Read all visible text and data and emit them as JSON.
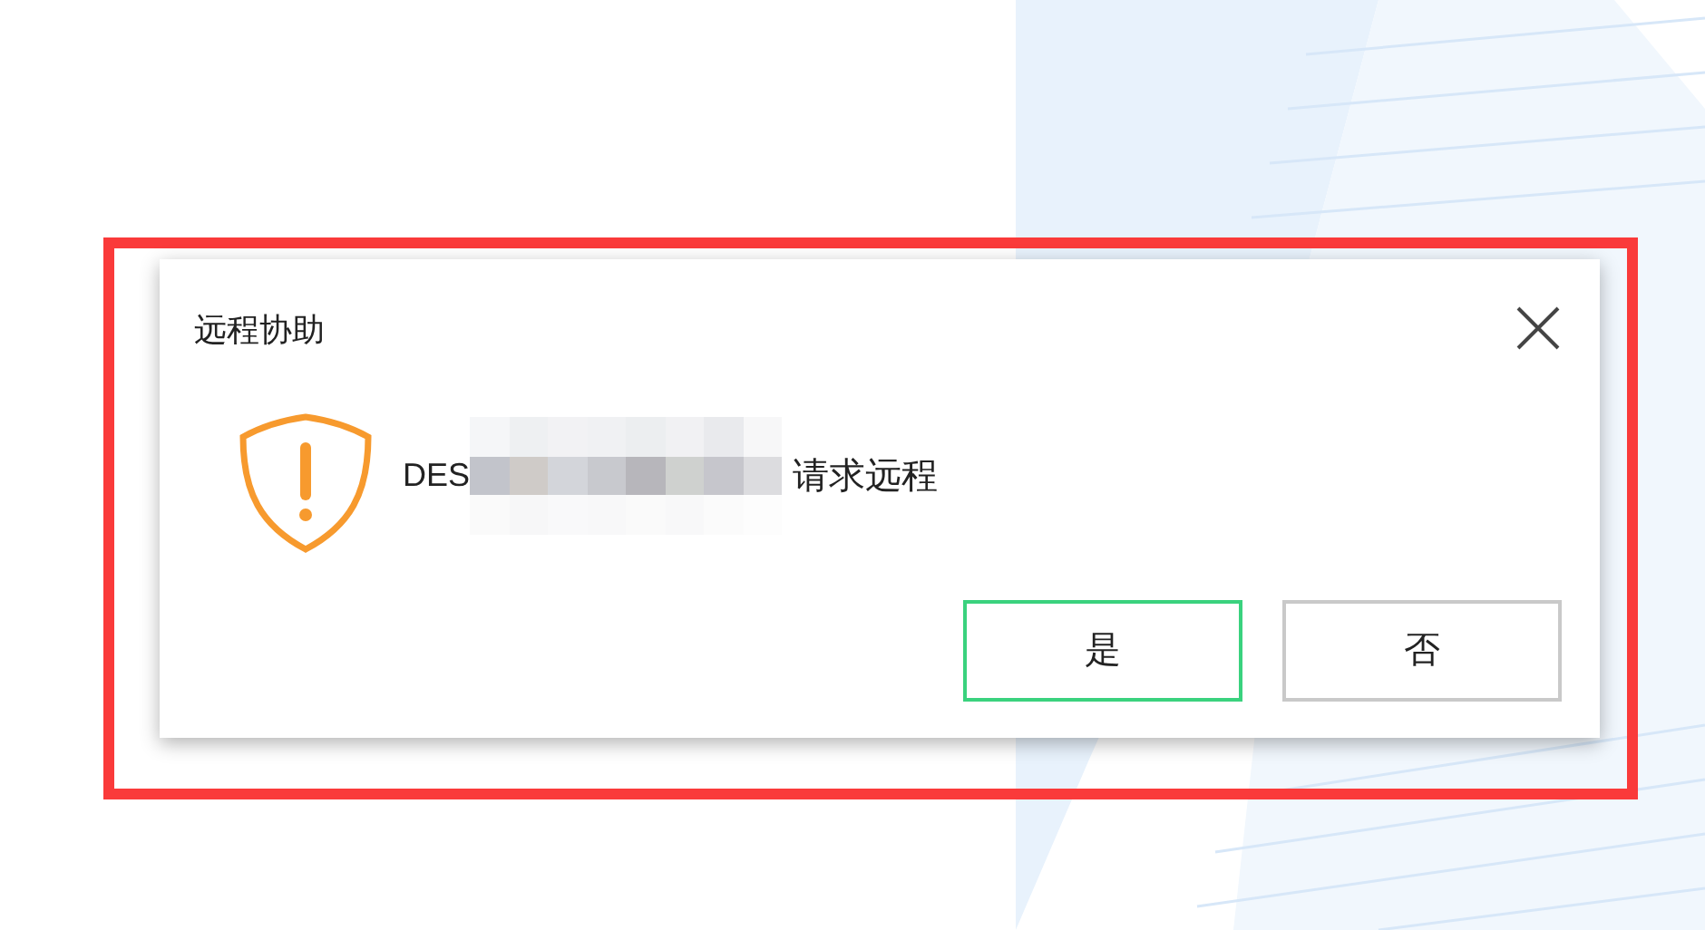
{
  "dialog": {
    "title": "远程协助",
    "message_prefix": "DES",
    "redacted": true,
    "message_suffix": "请求远程"
  },
  "buttons": [
    {
      "label": "是",
      "focused": true
    },
    {
      "label": "否",
      "focused": false
    }
  ],
  "annotation": {
    "color": "#fa3a3a"
  }
}
